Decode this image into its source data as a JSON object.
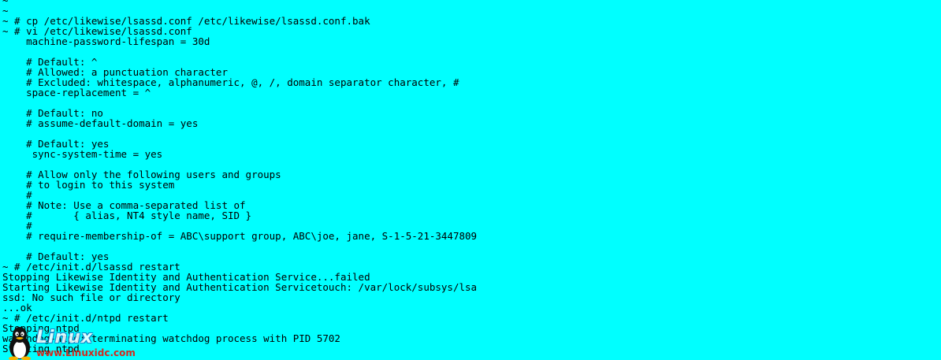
{
  "terminal": {
    "background": "#00ffff",
    "foreground": "#000000",
    "lines": [
      "~",
      "~",
      "~ # cp /etc/likewise/lsassd.conf /etc/likewise/lsassd.conf.bak",
      "~ # vi /etc/likewise/lsassd.conf",
      "    machine-password-lifespan = 30d",
      "",
      "    # Default: ^",
      "    # Allowed: a punctuation character",
      "    # Excluded: whitespace, alphanumeric, @, /, domain separator character, #",
      "    space-replacement = ^",
      "",
      "    # Default: no",
      "    # assume-default-domain = yes",
      "",
      "    # Default: yes",
      "     sync-system-time = yes",
      "",
      "    # Allow only the following users and groups",
      "    # to login to this system",
      "    #",
      "    # Note: Use a comma-separated list of",
      "    #       { alias, NT4 style name, SID }",
      "    #",
      "    # require-membership-of = ABC\\support group, ABC\\joe, jane, S-1-5-21-3447809",
      "",
      "    # Default: yes",
      "~ # /etc/init.d/lsassd restart",
      "Stopping Likewise Identity and Authentication Service...failed",
      "Starting Likewise Identity and Authentication Servicetouch: /var/lock/subsys/lsa",
      "ssd: No such file or directory",
      "...ok",
      "~ # /etc/init.d/ntpd restart",
      "Stopping ntpd",
      "watchdog-ntpd: terminating watchdog process with PID 5702",
      "Starting ntpd"
    ]
  },
  "watermark": {
    "brand": "Linux",
    "url": "www.Linuxidc.com",
    "icon": "tux-penguin-icon"
  }
}
